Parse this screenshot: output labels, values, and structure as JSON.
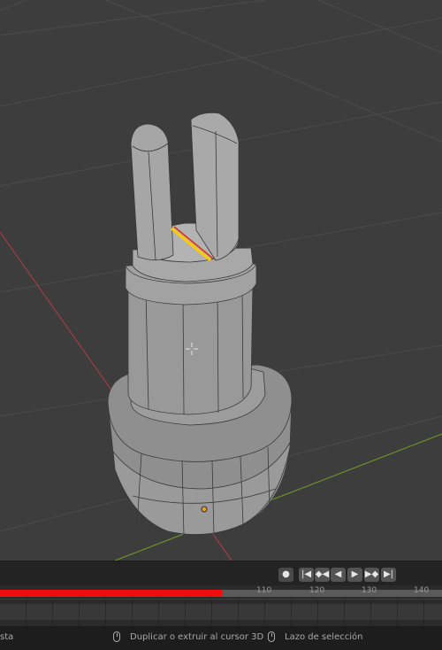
{
  "viewport": {
    "view": "3D Viewport",
    "object": "cylindrical mesh with two prongs",
    "selection": "edge",
    "colors": {
      "background": "#3d3d3d",
      "grid": "#4a4a4a",
      "x_axis": "#a13c44",
      "y_axis": "#6f8f2a",
      "mesh": "#8e8e8e",
      "selected_edge": "#ffcc00",
      "active_edge": "#e03010"
    }
  },
  "timeline": {
    "playback_icons": [
      "record-icon",
      "jump-to-start-icon",
      "prev-keyframe-icon",
      "play-reverse-icon",
      "play-icon",
      "next-keyframe-icon",
      "jump-to-end-icon"
    ],
    "playback_glyphs": [
      "●",
      "|◀",
      "◆◀",
      "◀",
      "▶",
      "▶◆",
      "▶|"
    ],
    "ticks": [
      "110",
      "120",
      "130",
      "140"
    ],
    "progress": 0.502,
    "progress_color": "#ee0d0d"
  },
  "statusbar": {
    "left_text": "sta",
    "hint1": "Duplicar o extruir al cursor 3D",
    "hint2": "Lazo de selección"
  }
}
